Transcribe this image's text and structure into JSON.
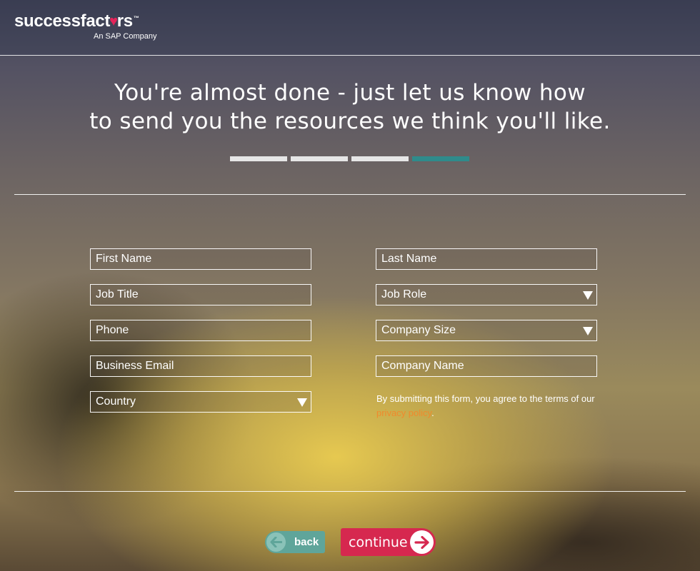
{
  "brand": {
    "name_part1": "successfact",
    "name_heart": "♥",
    "name_part2": "rs",
    "trademark": "™",
    "tagline": "An SAP Company",
    "heart_color": "#e4245a"
  },
  "headline": {
    "line1": "You're almost done - just let us know how",
    "line2": "to send you the resources we think you'll like."
  },
  "progress": {
    "total_steps": 4,
    "current_step": 4,
    "active_color": "#2f8b8b"
  },
  "form": {
    "first_name": {
      "placeholder": "First Name",
      "value": ""
    },
    "last_name": {
      "placeholder": "Last Name",
      "value": ""
    },
    "job_title": {
      "placeholder": "Job Title",
      "value": ""
    },
    "job_role": {
      "selected": "Job Role"
    },
    "phone": {
      "placeholder": "Phone",
      "value": ""
    },
    "company_size": {
      "selected": "Company Size"
    },
    "business_email": {
      "placeholder": "Business Email",
      "value": ""
    },
    "company_name": {
      "placeholder": "Company Name",
      "value": ""
    },
    "country": {
      "selected": "Country"
    }
  },
  "legal": {
    "text_before": "By submitting this form, you agree to the terms of our ",
    "link": "privacy policy",
    "text_after": ".",
    "link_color": "#f08a2c"
  },
  "buttons": {
    "back_label": "back",
    "continue_label": "continue",
    "back_color": "#5fa59a",
    "continue_color": "#d6284f"
  }
}
